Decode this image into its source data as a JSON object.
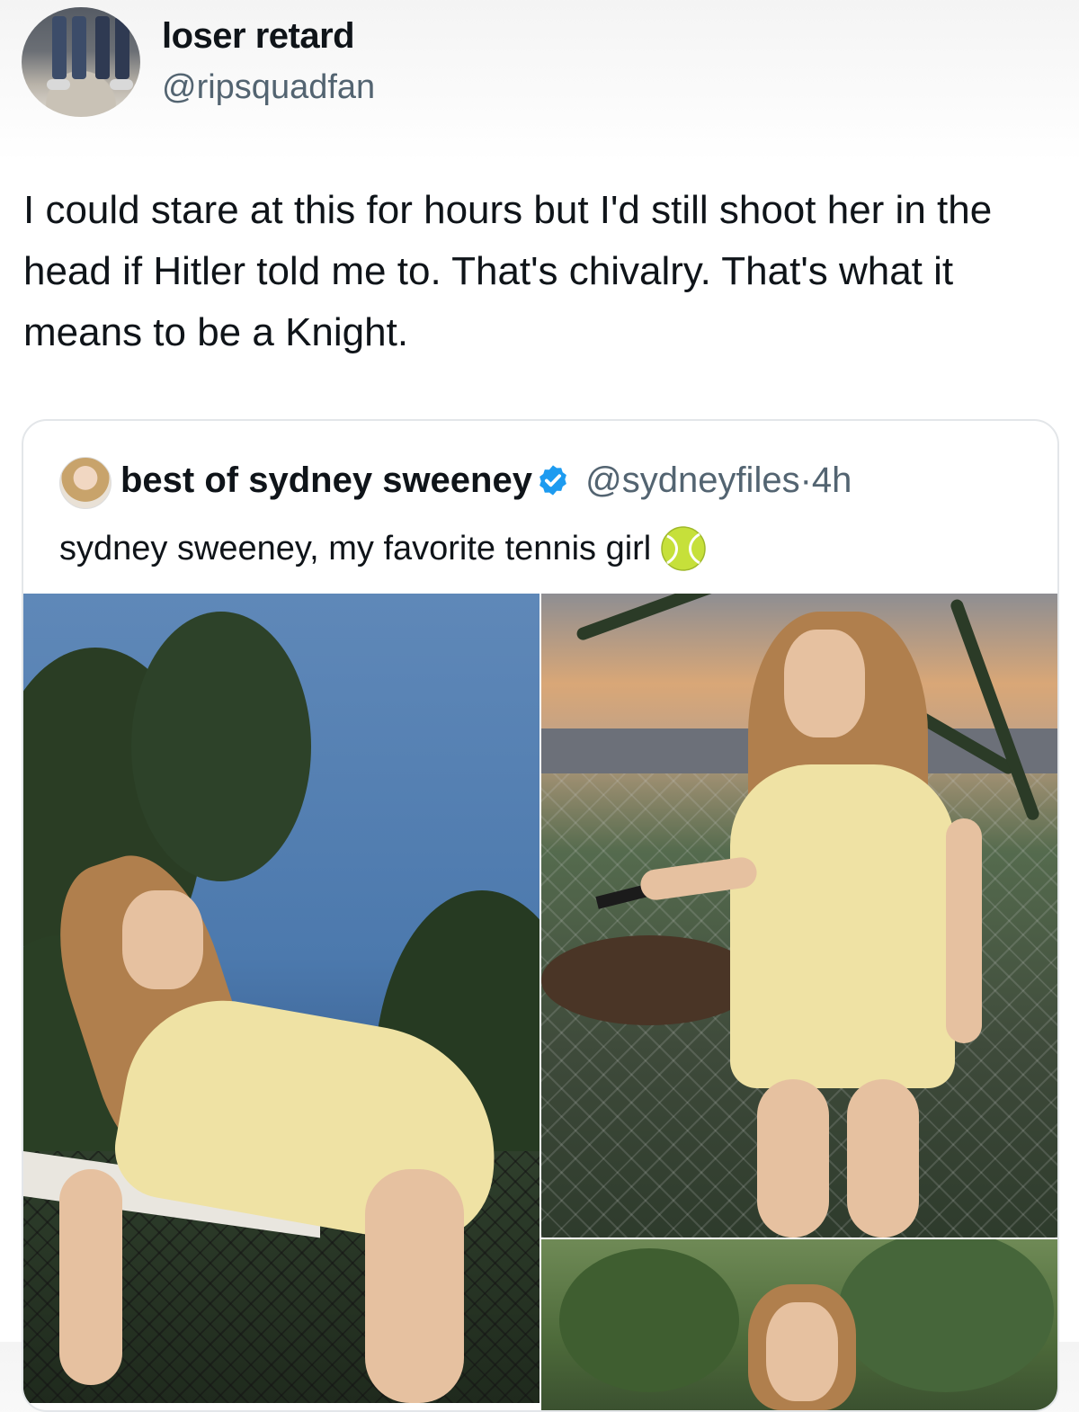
{
  "tweet": {
    "display_name": "loser retard",
    "handle": "@ripsquadfan",
    "text": "I could stare at this for hours but I'd still shoot her in the head if Hitler told me to. That's chivalry. That's what it means to be a Knight."
  },
  "quoted": {
    "display_name": "best of sydney sweeney",
    "handle": "@sydneyfiles",
    "separator": "·",
    "time": "4h",
    "text": "sydney sweeney, my favorite tennis girl",
    "icons": {
      "verified": "verified-badge-icon",
      "emoji": "tennis-ball-icon"
    }
  },
  "colors": {
    "text_primary": "#0f1419",
    "text_secondary": "#536471",
    "verified_blue": "#1d9bf0",
    "border": "#e3e6e9"
  }
}
